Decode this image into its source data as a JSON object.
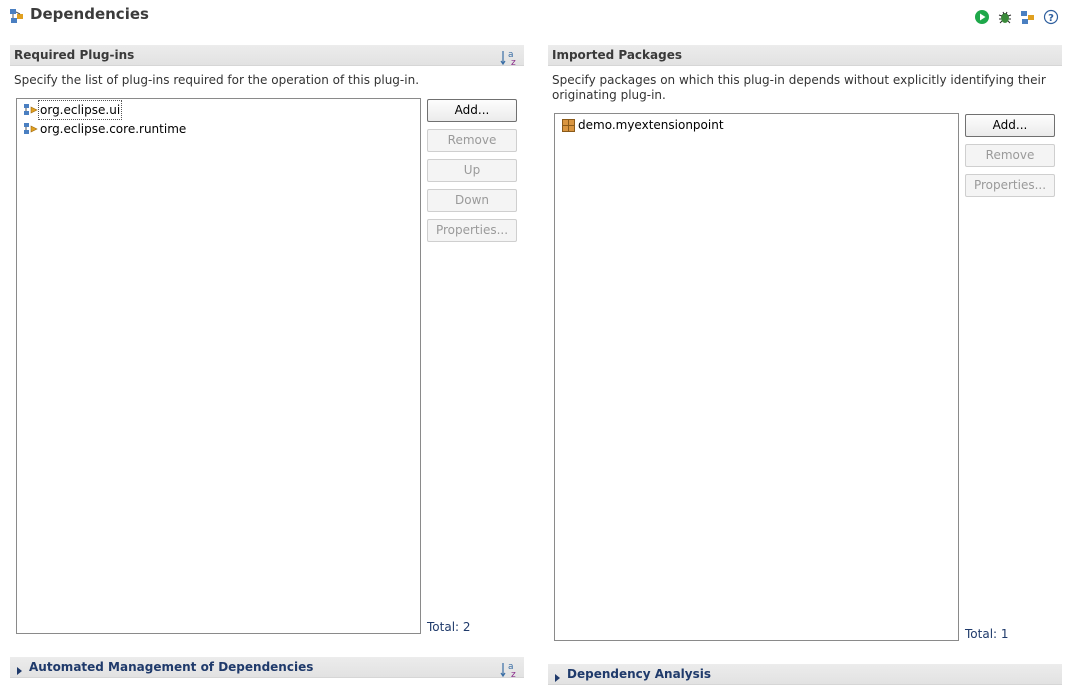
{
  "page": {
    "title": "Dependencies"
  },
  "header_icons": [
    "plugin-dependencies-icon",
    "run-icon",
    "debug-icon",
    "export-icon",
    "help-icon"
  ],
  "required_plugins": {
    "title": "Required Plug-ins",
    "description": "Specify the list of plug-ins required for the operation of this plug-in.",
    "items": [
      {
        "label": "org.eclipse.ui",
        "icon": "plugin-icon",
        "selected": true
      },
      {
        "label": "org.eclipse.core.runtime",
        "icon": "plugin-icon",
        "selected": false
      }
    ],
    "buttons": {
      "add": "Add...",
      "remove": "Remove",
      "up": "Up",
      "down": "Down",
      "properties": "Properties..."
    },
    "total": "Total: 2"
  },
  "imported_packages": {
    "title": "Imported Packages",
    "description": "Specify packages on which this plug-in depends without explicitly identifying their originating plug-in.",
    "items": [
      {
        "label": "demo.myextensionpoint",
        "icon": "package-icon"
      }
    ],
    "buttons": {
      "add": "Add...",
      "remove": "Remove",
      "properties": "Properties..."
    },
    "total": "Total: 1"
  },
  "automated_management": {
    "title": "Automated Management of Dependencies"
  },
  "dependency_analysis": {
    "title": "Dependency Analysis"
  },
  "sort": {
    "top": "a",
    "bottom": "z"
  },
  "colors": {
    "accent": "#1f3a6b",
    "run": "#1ea84a",
    "package": "#c9802a"
  }
}
